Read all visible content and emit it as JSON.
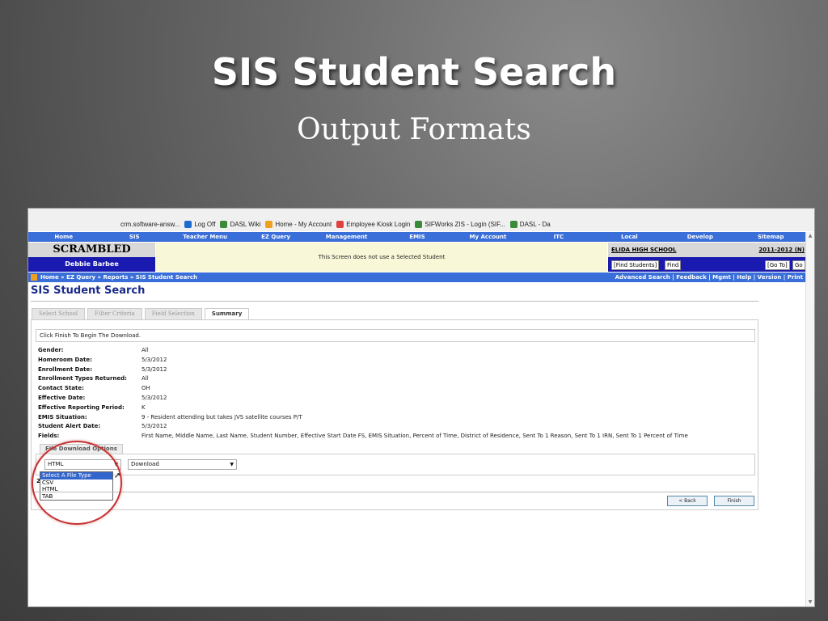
{
  "slide": {
    "title": "SIS Student Search",
    "subtitle": "Output Formats"
  },
  "browser": {
    "bookmarks": [
      {
        "label": "crm.software-answ...",
        "icon": "page-icon",
        "color": ""
      },
      {
        "label": "Log Off",
        "icon": "logoff-icon",
        "color": "#1c6cd0"
      },
      {
        "label": "DASL Wiki",
        "icon": "page-icon",
        "color": "#3a8a3a"
      },
      {
        "label": "Home - My Account",
        "icon": "home-icon",
        "color": "#f0a020"
      },
      {
        "label": "Employee Kiosk Login",
        "icon": "pen-icon",
        "color": "#e04040"
      },
      {
        "label": "SIFWorks ZIS - Login (SIF...",
        "icon": "page-icon",
        "color": "#3a8a3a"
      },
      {
        "label": "DASL - Da",
        "icon": "page-icon",
        "color": "#3a8a3a"
      }
    ]
  },
  "nav": [
    "Home",
    "SIS",
    "Teacher Menu",
    "EZ Query",
    "Management",
    "EMIS",
    "My Account",
    "ITC",
    "Local",
    "Develop",
    "Sitemap"
  ],
  "header": {
    "org": "SCRAMBLED",
    "user": "Debbie Barbee",
    "notice": "This Screen does not use a Selected Student",
    "school": "ELIDA HIGH SCHOOL",
    "year": "2011-2012 (N)",
    "find_students": "[Find Students]",
    "find_btn": "Find",
    "goto": "[Go To]",
    "go_btn": "Go"
  },
  "breadcrumb": {
    "left": "Home  » EZ Query  » Reports  » SIS Student Search",
    "right": "Advanced Search | Feedback | Mgmt | Help | Version | Print"
  },
  "page_title": "SIS Student Search",
  "tabs": [
    {
      "label": "Select School",
      "active": false
    },
    {
      "label": "Filter Criteria",
      "active": false
    },
    {
      "label": "Field Selection",
      "active": false
    },
    {
      "label": "Summary",
      "active": true
    }
  ],
  "message": "Click Finish To Begin The Download.",
  "summary": [
    {
      "key": "Gender:",
      "value": "All"
    },
    {
      "key": "Homeroom Date:",
      "value": "5/3/2012"
    },
    {
      "key": "Enrollment Date:",
      "value": "5/3/2012"
    },
    {
      "key": "Enrollment Types Returned:",
      "value": "All"
    },
    {
      "key": "Contact State:",
      "value": "OH"
    },
    {
      "key": "Effective Date:",
      "value": "5/3/2012"
    },
    {
      "key": "Effective Reporting Period:",
      "value": "K"
    },
    {
      "key": "EMIS Situation:",
      "value": "9 - Resident attending but takes JVS satellite courses P/T"
    },
    {
      "key": "Student Alert Date:",
      "value": "5/3/2012"
    },
    {
      "key": "Fields:",
      "value": "First Name, Middle Name, Last Name, Student Number, Effective Start Date FS, EMIS Situation, Percent of Time, District of Residence, Sent To 1 Reason, Sent To 1 IRN, Sent To 1 Percent of Time"
    }
  ],
  "file_download": {
    "section_label": "File Download Options",
    "file_type_value": "HTML",
    "download_value": "Download",
    "options": [
      "Select A File Type",
      "CSV",
      "HTML",
      "TAB"
    ],
    "highlighted_option": "Select A File Type"
  },
  "buttons": {
    "back": "< Back",
    "finish": "Finish"
  },
  "colors": {
    "nav_blue": "#3a6ed8",
    "dark_blue": "#1a1ab0",
    "title_blue": "#1a2a8a",
    "callout_red": "#c83030"
  }
}
